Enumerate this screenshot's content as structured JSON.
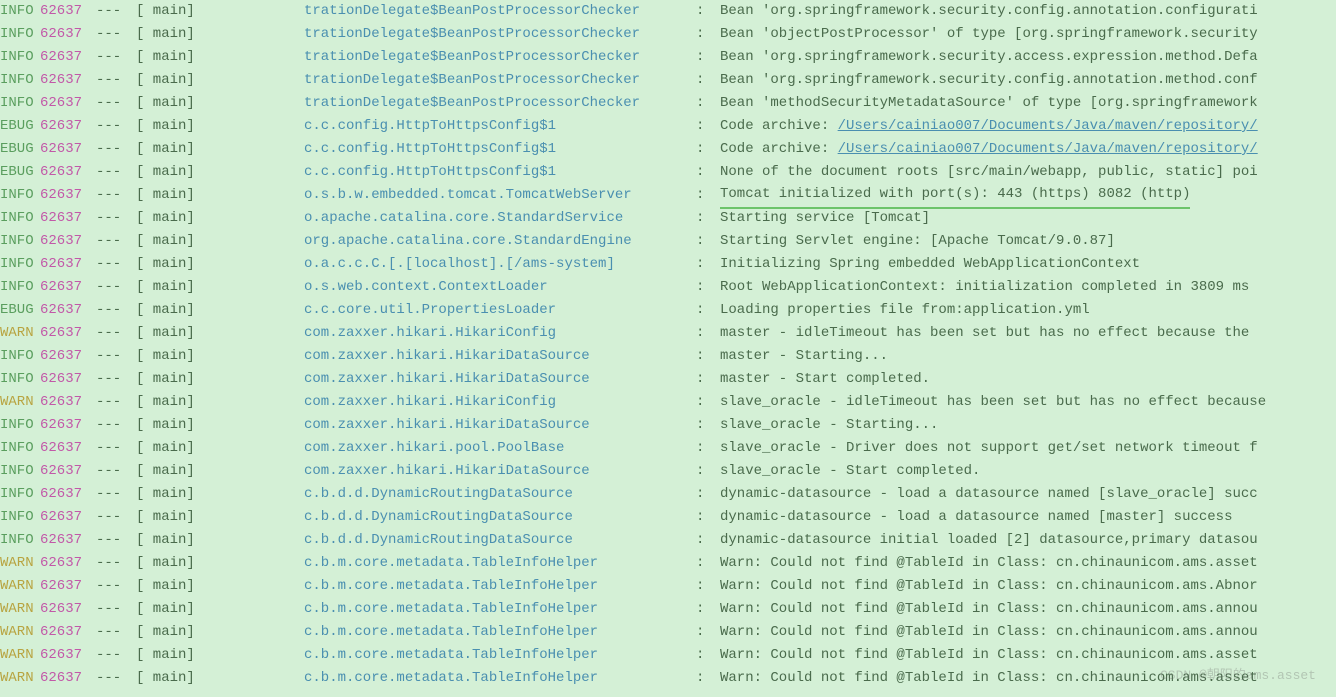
{
  "watermark": "CSDN @朝阳的ams.asset",
  "logs": [
    {
      "level": "INFO",
      "pid": "62637",
      "thread": "main",
      "logger": "trationDelegate$BeanPostProcessorChecker",
      "msg": "Bean 'org.springframework.security.config.annotation.configurati"
    },
    {
      "level": "INFO",
      "pid": "62637",
      "thread": "main",
      "logger": "trationDelegate$BeanPostProcessorChecker",
      "msg": "Bean 'objectPostProcessor' of type [org.springframework.security"
    },
    {
      "level": "INFO",
      "pid": "62637",
      "thread": "main",
      "logger": "trationDelegate$BeanPostProcessorChecker",
      "msg": "Bean 'org.springframework.security.access.expression.method.Defa"
    },
    {
      "level": "INFO",
      "pid": "62637",
      "thread": "main",
      "logger": "trationDelegate$BeanPostProcessorChecker",
      "msg": "Bean 'org.springframework.security.config.annotation.method.conf"
    },
    {
      "level": "INFO",
      "pid": "62637",
      "thread": "main",
      "logger": "trationDelegate$BeanPostProcessorChecker",
      "msg": "Bean 'methodSecurityMetadataSource' of type [org.springframework"
    },
    {
      "level": "DEBUG",
      "pid": "62637",
      "thread": "main",
      "logger": "c.c.config.HttpToHttpsConfig$1",
      "msg": "Code archive: ",
      "link": "/Users/cainiao007/Documents/Java/maven/repository/"
    },
    {
      "level": "DEBUG",
      "pid": "62637",
      "thread": "main",
      "logger": "c.c.config.HttpToHttpsConfig$1",
      "msg": "Code archive: ",
      "link": "/Users/cainiao007/Documents/Java/maven/repository/"
    },
    {
      "level": "DEBUG",
      "pid": "62637",
      "thread": "main",
      "logger": "c.c.config.HttpToHttpsConfig$1",
      "msg": "None of the document roots [src/main/webapp, public, static] poi"
    },
    {
      "level": "INFO",
      "pid": "62637",
      "thread": "main",
      "logger": "o.s.b.w.embedded.tomcat.TomcatWebServer",
      "msg": "Tomcat initialized with port(s): 443 (https) 8082 (http)",
      "underlined": true
    },
    {
      "level": "INFO",
      "pid": "62637",
      "thread": "main",
      "logger": "o.apache.catalina.core.StandardService",
      "msg": "Starting service [Tomcat]"
    },
    {
      "level": "INFO",
      "pid": "62637",
      "thread": "main",
      "logger": "org.apache.catalina.core.StandardEngine",
      "msg": "Starting Servlet engine: [Apache Tomcat/9.0.87]"
    },
    {
      "level": "INFO",
      "pid": "62637",
      "thread": "main",
      "logger": "o.a.c.c.C.[.[localhost].[/ams-system]",
      "msg": "Initializing Spring embedded WebApplicationContext"
    },
    {
      "level": "INFO",
      "pid": "62637",
      "thread": "main",
      "logger": "o.s.web.context.ContextLoader",
      "msg": "Root WebApplicationContext: initialization completed in 3809 ms"
    },
    {
      "level": "DEBUG",
      "pid": "62637",
      "thread": "main",
      "logger": "c.c.core.util.PropertiesLoader",
      "msg": "Loading properties file from:application.yml"
    },
    {
      "level": "WARN",
      "pid": "62637",
      "thread": "main",
      "logger": "com.zaxxer.hikari.HikariConfig",
      "msg": "master - idleTimeout has been set but has no effect because the"
    },
    {
      "level": "INFO",
      "pid": "62637",
      "thread": "main",
      "logger": "com.zaxxer.hikari.HikariDataSource",
      "msg": "master - Starting..."
    },
    {
      "level": "INFO",
      "pid": "62637",
      "thread": "main",
      "logger": "com.zaxxer.hikari.HikariDataSource",
      "msg": "master - Start completed."
    },
    {
      "level": "WARN",
      "pid": "62637",
      "thread": "main",
      "logger": "com.zaxxer.hikari.HikariConfig",
      "msg": "slave_oracle - idleTimeout has been set but has no effect because"
    },
    {
      "level": "INFO",
      "pid": "62637",
      "thread": "main",
      "logger": "com.zaxxer.hikari.HikariDataSource",
      "msg": "slave_oracle - Starting..."
    },
    {
      "level": "INFO",
      "pid": "62637",
      "thread": "main",
      "logger": "com.zaxxer.hikari.pool.PoolBase",
      "msg": "slave_oracle - Driver does not support get/set network timeout f"
    },
    {
      "level": "INFO",
      "pid": "62637",
      "thread": "main",
      "logger": "com.zaxxer.hikari.HikariDataSource",
      "msg": "slave_oracle - Start completed."
    },
    {
      "level": "INFO",
      "pid": "62637",
      "thread": "main",
      "logger": "c.b.d.d.DynamicRoutingDataSource",
      "msg": "dynamic-datasource - load a datasource named [slave_oracle] succ"
    },
    {
      "level": "INFO",
      "pid": "62637",
      "thread": "main",
      "logger": "c.b.d.d.DynamicRoutingDataSource",
      "msg": "dynamic-datasource - load a datasource named [master] success"
    },
    {
      "level": "INFO",
      "pid": "62637",
      "thread": "main",
      "logger": "c.b.d.d.DynamicRoutingDataSource",
      "msg": "dynamic-datasource initial loaded [2] datasource,primary datasou"
    },
    {
      "level": "WARN",
      "pid": "62637",
      "thread": "main",
      "logger": "c.b.m.core.metadata.TableInfoHelper",
      "msg": "Warn: Could not find @TableId in Class: cn.chinaunicom.ams.asset"
    },
    {
      "level": "WARN",
      "pid": "62637",
      "thread": "main",
      "logger": "c.b.m.core.metadata.TableInfoHelper",
      "msg": "Warn: Could not find @TableId in Class: cn.chinaunicom.ams.Abnor"
    },
    {
      "level": "WARN",
      "pid": "62637",
      "thread": "main",
      "logger": "c.b.m.core.metadata.TableInfoHelper",
      "msg": "Warn: Could not find @TableId in Class: cn.chinaunicom.ams.annou"
    },
    {
      "level": "WARN",
      "pid": "62637",
      "thread": "main",
      "logger": "c.b.m.core.metadata.TableInfoHelper",
      "msg": "Warn: Could not find @TableId in Class: cn.chinaunicom.ams.annou"
    },
    {
      "level": "WARN",
      "pid": "62637",
      "thread": "main",
      "logger": "c.b.m.core.metadata.TableInfoHelper",
      "msg": "Warn: Could not find @TableId in Class: cn.chinaunicom.ams.asset"
    },
    {
      "level": "WARN",
      "pid": "62637",
      "thread": "main",
      "logger": "c.b.m.core.metadata.TableInfoHelper",
      "msg": "Warn: Could not find @TableId in Class: cn.chinaunicom.ams.asset"
    }
  ]
}
